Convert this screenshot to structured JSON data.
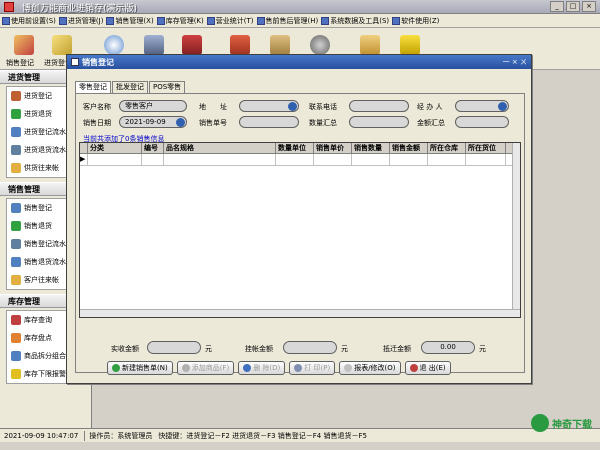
{
  "app": {
    "title": "博创万能商业进销存(演示版)"
  },
  "menu": [
    "使用前设置(S)",
    "进货管理(J)",
    "销售管理(X)",
    "库存管理(K)",
    "营业统计(T)",
    "售前售后管理(H)",
    "系统数据及工具(S)",
    "软件使用(Z)"
  ],
  "toolbar": {
    "items": [
      "销售登记",
      "进货登记"
    ]
  },
  "sidebar": {
    "sections": [
      {
        "title": "进货管理",
        "items": [
          "进货登记",
          "进货退货",
          "进货登记流水",
          "进货退货流水",
          "供货往来帐"
        ]
      },
      {
        "title": "销售管理",
        "items": [
          "销售登记",
          "销售退货",
          "销售登记流水",
          "销售退货流水",
          "客户往来帐"
        ]
      },
      {
        "title": "库存管理",
        "items": [
          "库存查询",
          "库存盘点",
          "商品拆分组合",
          "库存下限报警"
        ]
      }
    ]
  },
  "dialog": {
    "title": "销售登记",
    "close_label": "一 × ㄨ",
    "tabs": [
      "零售登记",
      "批发登记",
      "POS零售"
    ],
    "labels": {
      "customer": "客户名称",
      "address": "地　　址",
      "phone": "联系电话",
      "handler": "经 办 人",
      "date": "销售日期",
      "order_no": "销售单号",
      "qty_total": "数量汇总",
      "amount_total": "金额汇总"
    },
    "values": {
      "customer": "零售客户",
      "date": "2021-09-09"
    },
    "info_line": "当前共添加了0条销售信息",
    "grid_columns": [
      "分类",
      "编号",
      "品名规格",
      "数量单位",
      "销售单价",
      "销售数量",
      "销售金额",
      "所在仓库",
      "所在货位"
    ],
    "row_marker": "▶",
    "footer": {
      "paid_label": "实收金额",
      "unit1": "元",
      "credit_label": "挂帐金额",
      "unit2": "元",
      "discount_label": "抵迁金额",
      "discount_value": "0.00",
      "unit3": "元"
    },
    "buttons": {
      "new_order": "新建销售单(N)",
      "add_item": "添加商品(F)",
      "delete_item": "删 除(D)",
      "print": "打 印(P)",
      "report": "报表/修改(O)",
      "exit": "退 出(E)"
    }
  },
  "status": {
    "datetime": "2021-09-09  10:47:07",
    "operator": "操作员：系统管理员",
    "shortcut": "快捷键：进货登记－F2  进货退货－F3  销售登记－F4  销售退货－F5"
  },
  "watermark": {
    "text": "神奇下载"
  }
}
